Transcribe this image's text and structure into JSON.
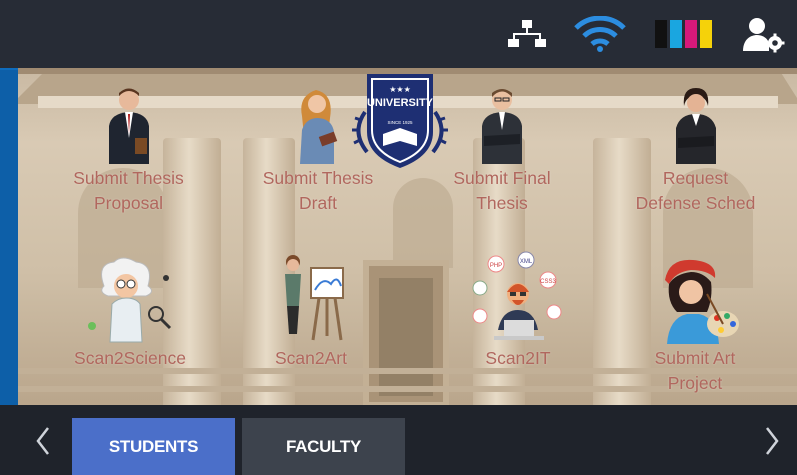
{
  "status_bar": {
    "icons": [
      "network-icon",
      "wifi-icon",
      "ink-levels-icon",
      "user-settings-icon"
    ],
    "ink_colors": [
      "#111111",
      "#1aa6e0",
      "#d6197a",
      "#f5d20a"
    ]
  },
  "logo": {
    "top_text": "UNIVERSITY",
    "bottom_text": "SINCE 1925"
  },
  "tiles": [
    {
      "label": "Submit Thesis\nProposal",
      "icon": "businessman-icon"
    },
    {
      "label": "Submit Thesis\nDraft",
      "icon": "woman-reading-icon"
    },
    {
      "label": "Submit Final\nThesis",
      "icon": "man-arms-crossed-icon"
    },
    {
      "label": "Request\nDefense Sched",
      "icon": "woman-arms-crossed-icon"
    },
    {
      "label": "Scan2Science",
      "icon": "scientist-icon"
    },
    {
      "label": "Scan2Art",
      "icon": "painter-easel-icon"
    },
    {
      "label": "Scan2IT",
      "icon": "programmer-icon"
    },
    {
      "label": "Submit Art\nProject",
      "icon": "artist-palette-icon"
    }
  ],
  "tabs": {
    "students": "STUDENTS",
    "faculty": "FACULTY",
    "active": "STUDENTS"
  },
  "colors": {
    "accent": "#4b6fc9",
    "label": "#b1675e",
    "topbar": "#272c36",
    "frame": "#0e6cbd"
  }
}
